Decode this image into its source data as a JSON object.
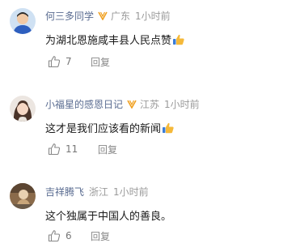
{
  "comments": [
    {
      "name": "何三多同学",
      "location": "广东",
      "time": "1小时前",
      "text": "为湖北恩施咸丰县人民点赞",
      "likes": "7",
      "reply_label": "回复",
      "has_badge": true,
      "has_emoji": true
    },
    {
      "name": "小福星的感恩日记",
      "location": "江苏",
      "time": "1小时前",
      "text": "这才是我们应该看的新闻",
      "likes": "11",
      "reply_label": "回复",
      "has_badge": true,
      "has_emoji": true
    },
    {
      "name": "吉祥腾飞",
      "location": "浙江",
      "time": "1小时前",
      "text": "这个独属于中国人的善良。",
      "likes": "6",
      "reply_label": "回复",
      "has_badge": false,
      "has_emoji": false
    }
  ],
  "colors": {
    "name": "#5a6c91",
    "meta": "#9a9a9a",
    "badge": "#f0a020"
  }
}
